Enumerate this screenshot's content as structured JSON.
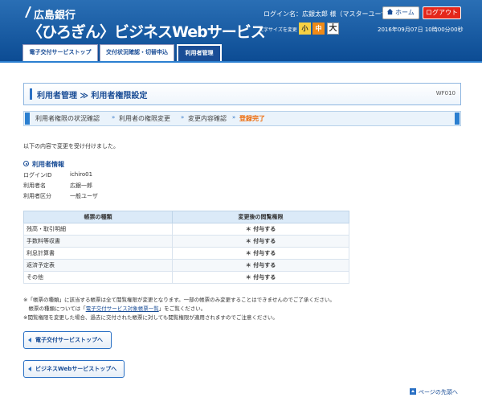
{
  "header": {
    "bank_name": "広島銀行",
    "service_title": "〈ひろぎん〉ビジネスWebサービス",
    "login_name": "ログイン名：広銀太郎 様（マスターユーザ）",
    "home_label": "ホーム",
    "logout_label": "ログアウト",
    "font_size_label": "文字サイズを変更",
    "font_small": "小",
    "font_mid": "中",
    "font_large": "大",
    "datetime": "2016年09月07日 10時00分00秒"
  },
  "tabs": [
    {
      "label": "電子交付サービストップ"
    },
    {
      "label": "交付状況確認・切替申込"
    },
    {
      "label": "利用者管理"
    }
  ],
  "page": {
    "title": "利用者管理 ≫ 利用者権限設定",
    "screen_id": "WF010"
  },
  "steps": [
    {
      "label": "利用者権限の状況確認"
    },
    {
      "label": "利用者の権限変更"
    },
    {
      "label": "変更内容確認"
    },
    {
      "label": "登録完了"
    }
  ],
  "step_separator": "»",
  "message": "以下の内容で変更を受け付けました。",
  "user_info": {
    "heading": "利用者情報",
    "rows": [
      {
        "label": "ログインID",
        "value": "ichiro01"
      },
      {
        "label": "利用者名",
        "value": "広銀一郎"
      },
      {
        "label": "利用者区分",
        "value": "一般ユーザ"
      }
    ]
  },
  "table": {
    "headers": [
      "帳票の種類",
      "変更後の閲覧権限"
    ],
    "rows": [
      {
        "type": "残高・取引明細",
        "permission": "＊ 付与する"
      },
      {
        "type": "手数料等収書",
        "permission": "＊ 付与する"
      },
      {
        "type": "利息計算書",
        "permission": "＊ 付与する"
      },
      {
        "type": "返済予定表",
        "permission": "＊ 付与する"
      },
      {
        "type": "その他",
        "permission": "＊ 付与する"
      }
    ]
  },
  "notes": {
    "line1": "※「帳票の種類」に該当する帳票は全て閲覧権限が変更となります。一部の帳票のみ変更することはできませんのでご了承ください。",
    "line2_prefix": "　帳票の種類については「",
    "line2_link": "電子交付サービス対象帳票一覧",
    "line2_suffix": "」をご覧ください。",
    "line3": "※閲覧権限を変更した場合、過去に交付された帳票に対しても閲覧権限が適用されますのでご注意ください。"
  },
  "buttons": {
    "back_top": "電子交付サービストップへ",
    "back_business": "ビジネスWebサービストップへ"
  },
  "page_top": "ページの先頭へ"
}
